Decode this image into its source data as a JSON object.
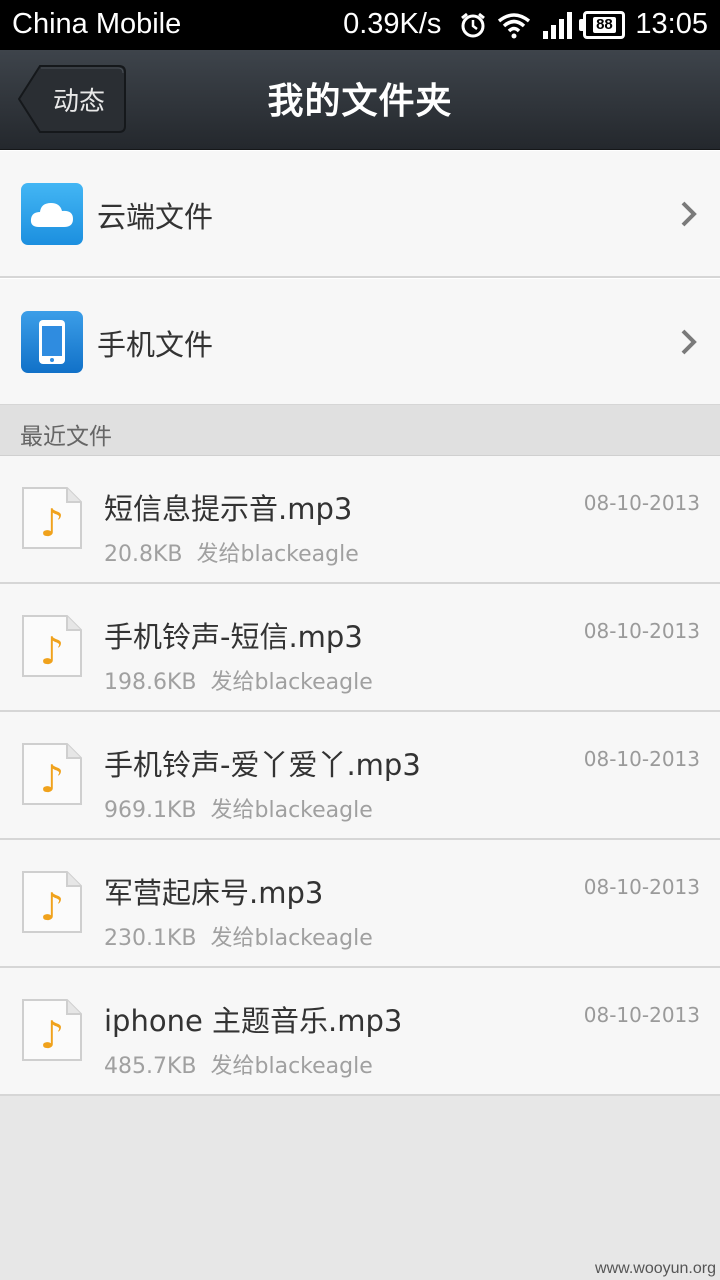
{
  "status_bar": {
    "carrier": "China Mobile",
    "speed": "0.39K/s",
    "battery": "88",
    "time": "13:05"
  },
  "header": {
    "back_label": "动态",
    "title": "我的文件夹"
  },
  "folders": [
    {
      "label": "云端文件",
      "icon": "cloud-icon"
    },
    {
      "label": "手机文件",
      "icon": "phone-icon"
    }
  ],
  "recent_section": {
    "label": "最近文件"
  },
  "files": [
    {
      "name": "短信息提示音.mp3",
      "size": "20.8KB",
      "sent_to": "发给blackeagle",
      "date": "08-10-2013"
    },
    {
      "name": "手机铃声-短信.mp3",
      "size": "198.6KB",
      "sent_to": "发给blackeagle",
      "date": "08-10-2013"
    },
    {
      "name": "手机铃声-爱丫爱丫.mp3",
      "size": "969.1KB",
      "sent_to": "发给blackeagle",
      "date": "08-10-2013"
    },
    {
      "name": "军营起床号.mp3",
      "size": "230.1KB",
      "sent_to": "发给blackeagle",
      "date": "08-10-2013"
    },
    {
      "name": "iphone 主题音乐.mp3",
      "size": "485.7KB",
      "sent_to": "发给blackeagle",
      "date": "08-10-2013"
    }
  ],
  "watermark": "www.wooyun.org",
  "colors": {
    "header_bg": "#2e3338",
    "row_bg": "#f7f7f7",
    "music_note": "#f0a21c"
  }
}
